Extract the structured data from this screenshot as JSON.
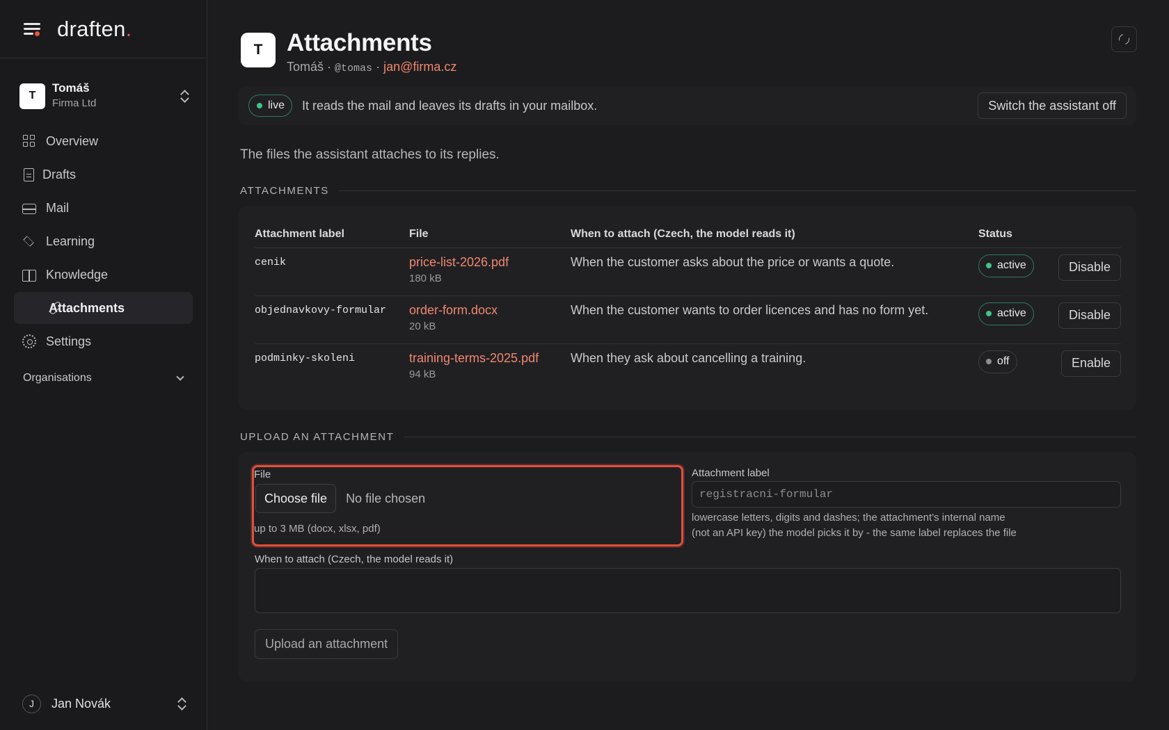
{
  "brand": {
    "name": "draften",
    "dot": "."
  },
  "account": {
    "initial": "T",
    "name": "Tomáš",
    "org": "Firma Ltd"
  },
  "nav": {
    "items": [
      {
        "label": "Overview",
        "icon": "grid-icon"
      },
      {
        "label": "Drafts",
        "icon": "document-icon"
      },
      {
        "label": "Mail",
        "icon": "inbox-icon"
      },
      {
        "label": "Learning",
        "icon": "graduation-cap-icon"
      },
      {
        "label": "Knowledge",
        "icon": "book-icon"
      }
    ],
    "active_sub": {
      "label": "Attachments",
      "icon": "paperclip-icon"
    },
    "settings": {
      "label": "Settings",
      "icon": "gear-icon"
    },
    "section": "Organisations"
  },
  "user": {
    "initial": "J",
    "name": "Jan Novák"
  },
  "header": {
    "initial": "T",
    "title": "Attachments",
    "name": "Tomáš",
    "sep1": "·",
    "handle": "@tomas",
    "sep2": "·",
    "email": "jan@firma.cz"
  },
  "status": {
    "pill": "live",
    "text": "It reads the mail and leaves its drafts in your mailbox.",
    "switch_label": "Switch the assistant off"
  },
  "intro": "The files the assistant attaches to its replies.",
  "attachments_section": "ATTACHMENTS",
  "table": {
    "columns": [
      "Attachment label",
      "File",
      "When to attach (Czech, the model reads it)",
      "Status"
    ],
    "rows": [
      {
        "label": "cenik",
        "file": "price-list-2026.pdf",
        "size": "180 kB",
        "when": "When the customer asks about the price or wants a quote.",
        "status": "active",
        "action": "Disable"
      },
      {
        "label": "objednavkovy-formular",
        "file": "order-form.docx",
        "size": "20 kB",
        "when": "When the customer wants to order licences and has no form yet.",
        "status": "active",
        "action": "Disable"
      },
      {
        "label": "podminky-skoleni",
        "file": "training-terms-2025.pdf",
        "size": "94 kB",
        "when": "When they ask about cancelling a training.",
        "status": "off",
        "action": "Enable"
      }
    ]
  },
  "upload_section": "UPLOAD AN ATTACHMENT",
  "upload": {
    "file_label": "File",
    "choose_label": "Choose file",
    "no_file": "No file chosen",
    "file_hint": "up to 3 MB (docx, xlsx, pdf)",
    "label_label": "Attachment label",
    "label_placeholder": "registracni-formular",
    "label_hint_1": "lowercase letters, digits and dashes; the attachment's internal name",
    "label_hint_2": "(not an API key) the model picks it by - the same label replaces the file",
    "when_label": "When to attach (Czech, the model reads it)",
    "submit_label": "Upload an attachment"
  },
  "colors": {
    "accent": "#e8553f",
    "link": "#f0876f",
    "success": "#3ec48c",
    "background": "#1c1c1e"
  }
}
